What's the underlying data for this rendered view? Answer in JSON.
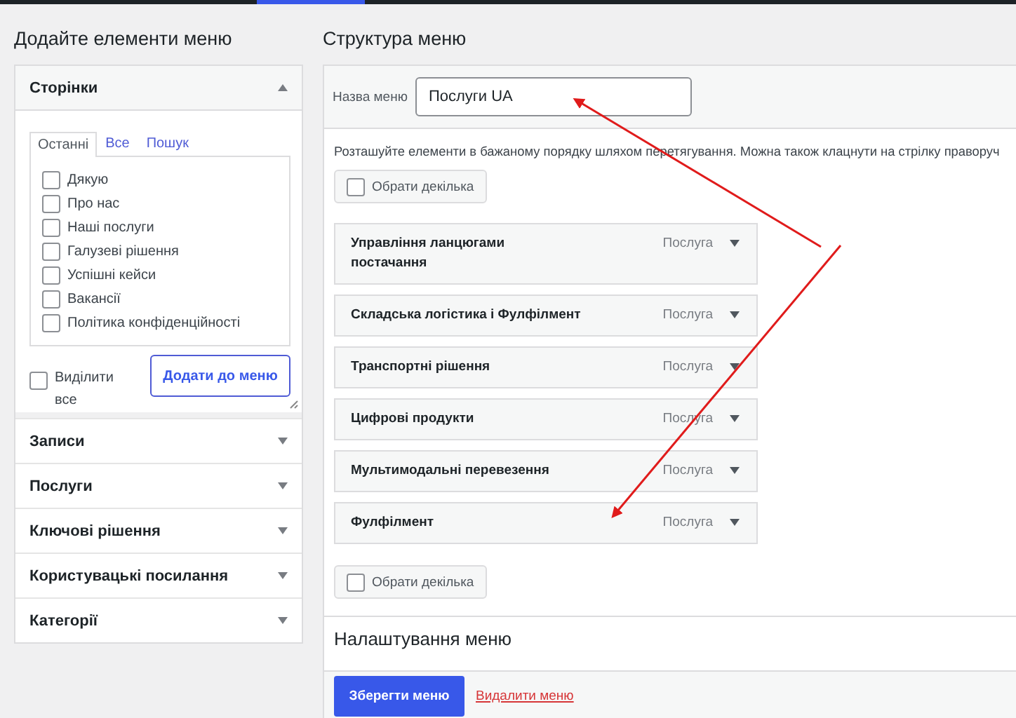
{
  "add_items": {
    "title": "Додайте елементи меню",
    "sections": [
      {
        "label": "Сторінки",
        "expanded": true,
        "tabs": [
          {
            "label": "Останні",
            "selected": true
          },
          {
            "label": "Все",
            "selected": false
          },
          {
            "label": "Пошук",
            "selected": false
          }
        ],
        "items": [
          {
            "label": "Дякую",
            "checked": false
          },
          {
            "label": "Про нас",
            "checked": false
          },
          {
            "label": "Наші послуги",
            "checked": false
          },
          {
            "label": "Галузеві рішення",
            "checked": false
          },
          {
            "label": "Успішні кейси",
            "checked": false
          },
          {
            "label": "Вакансії",
            "checked": false
          },
          {
            "label": "Політика конфіденційності",
            "checked": false
          }
        ],
        "select_all": {
          "label": "Виділити все",
          "checked": false
        },
        "add_button": "Додати до меню"
      },
      {
        "label": "Записи",
        "expanded": false
      },
      {
        "label": "Послуги",
        "expanded": false
      },
      {
        "label": "Ключові рішення",
        "expanded": false
      },
      {
        "label": "Користувацькі посилання",
        "expanded": false
      },
      {
        "label": "Категорії",
        "expanded": false
      }
    ]
  },
  "structure": {
    "title": "Структура меню",
    "name_label": "Назва меню",
    "name_value": "Послуги UA",
    "hint": "Розташуйте елементи в бажаному порядку шляхом перетягування. Можна також клацнути на стрілку праворуч",
    "bulk_select_top": {
      "label": "Обрати декілька",
      "checked": false
    },
    "items": [
      {
        "title": "Управління ланцюгами постачання",
        "type": "Послуга"
      },
      {
        "title": "Складська логістика і Фулфілмент",
        "type": "Послуга"
      },
      {
        "title": "Транспортні рішення",
        "type": "Послуга"
      },
      {
        "title": "Цифрові продукти",
        "type": "Послуга"
      },
      {
        "title": "Мультимодальні перевезення",
        "type": "Послуга"
      },
      {
        "title": "Фулфілмент",
        "type": "Послуга"
      }
    ],
    "bulk_select_bottom": {
      "label": "Обрати декілька",
      "checked": false
    },
    "settings_title": "Налаштування меню",
    "save_button": "Зберегти меню",
    "delete_link": "Видалити меню"
  }
}
